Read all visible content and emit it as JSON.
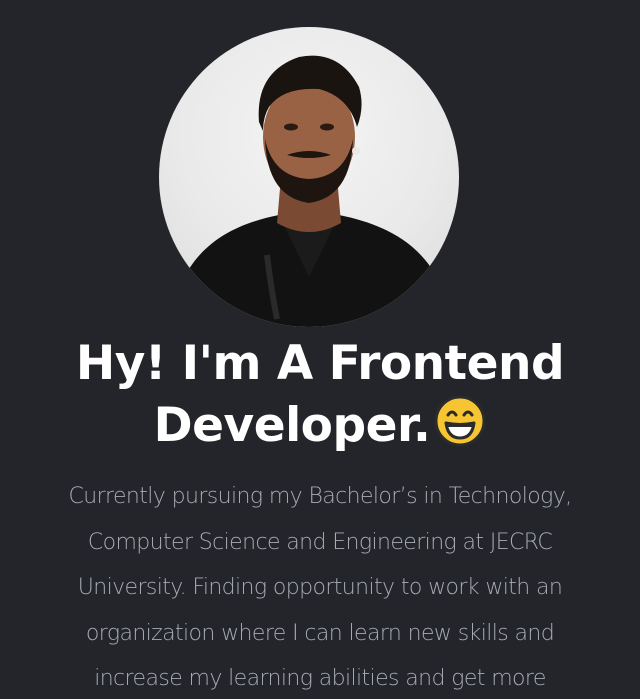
{
  "hero": {
    "profile_photo": "profile-photo",
    "heading_lines": [
      "Hy! I'm A Frontend",
      "Developer."
    ],
    "heading_emoji": "grinning-face-with-smiling-eyes-emoji",
    "bio_lines": [
      "Currently pursuing my Bachelor’s in Technology,",
      "Computer Science and Engineering at JECRC",
      "University. Finding opportunity to work with an",
      "organization where I can learn new skills and",
      "increase my learning abilities and get more"
    ]
  },
  "colors": {
    "background": "#23252a",
    "heading": "#ffffff",
    "bio_text": "#a7abb3",
    "emoji_face": "#f7c531"
  }
}
